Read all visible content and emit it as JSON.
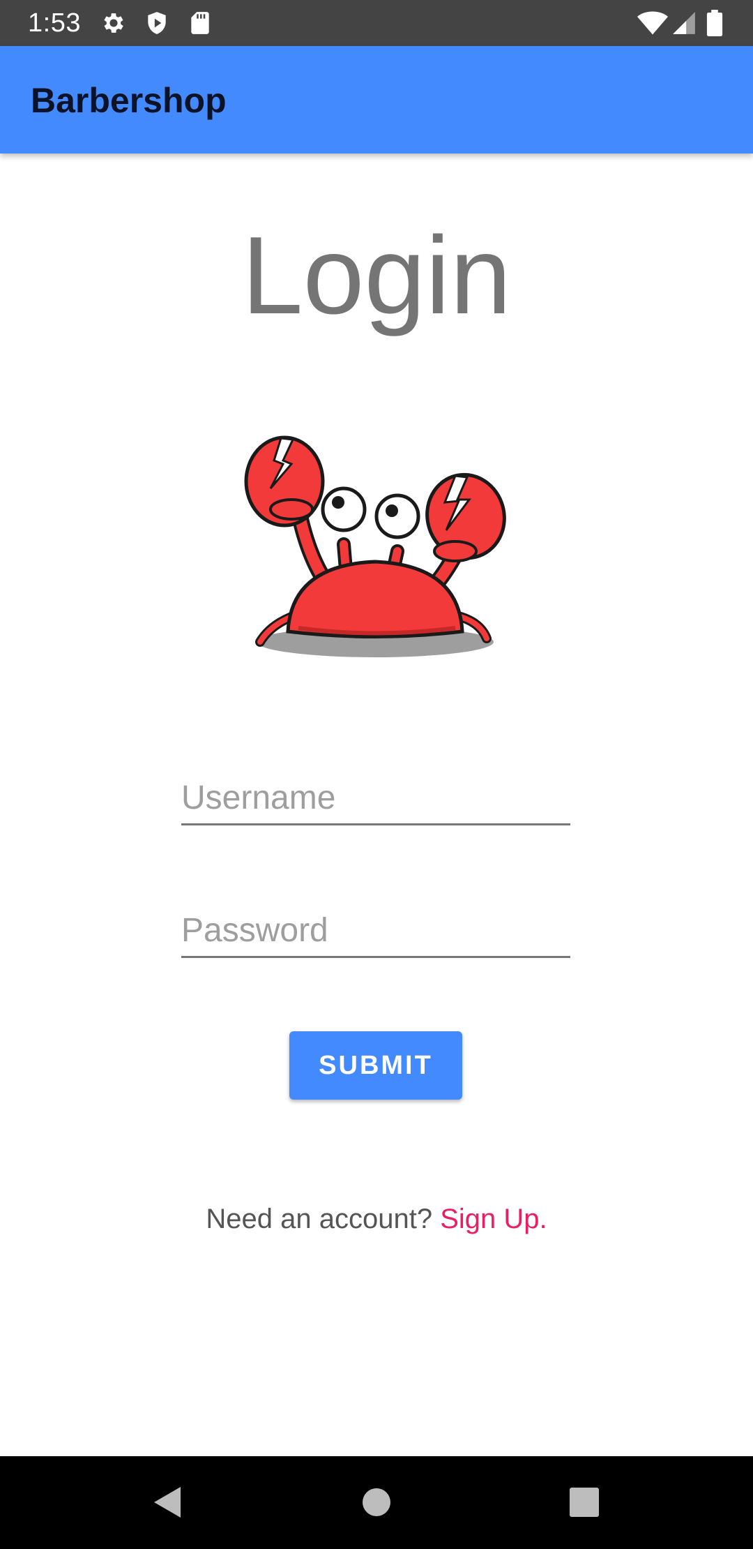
{
  "status_bar": {
    "time": "1:53",
    "left_icons": [
      "gear-icon",
      "shield-play-icon",
      "sd-card-icon"
    ],
    "right_icons": [
      "wifi-icon",
      "signal-icon",
      "battery-icon"
    ]
  },
  "app_bar": {
    "title": "Barbershop",
    "color": "#448aff"
  },
  "login": {
    "title": "Login",
    "logo_icon": "crab-icon",
    "username_placeholder": "Username",
    "username_value": "",
    "password_placeholder": "Password",
    "password_value": "",
    "submit_label": "SUBMIT",
    "signup_prompt": "Need an account?",
    "signup_link": "Sign Up.",
    "link_color": "#e91e63"
  },
  "nav_bar": {
    "buttons": [
      "back-icon",
      "home-icon",
      "recents-icon"
    ]
  }
}
